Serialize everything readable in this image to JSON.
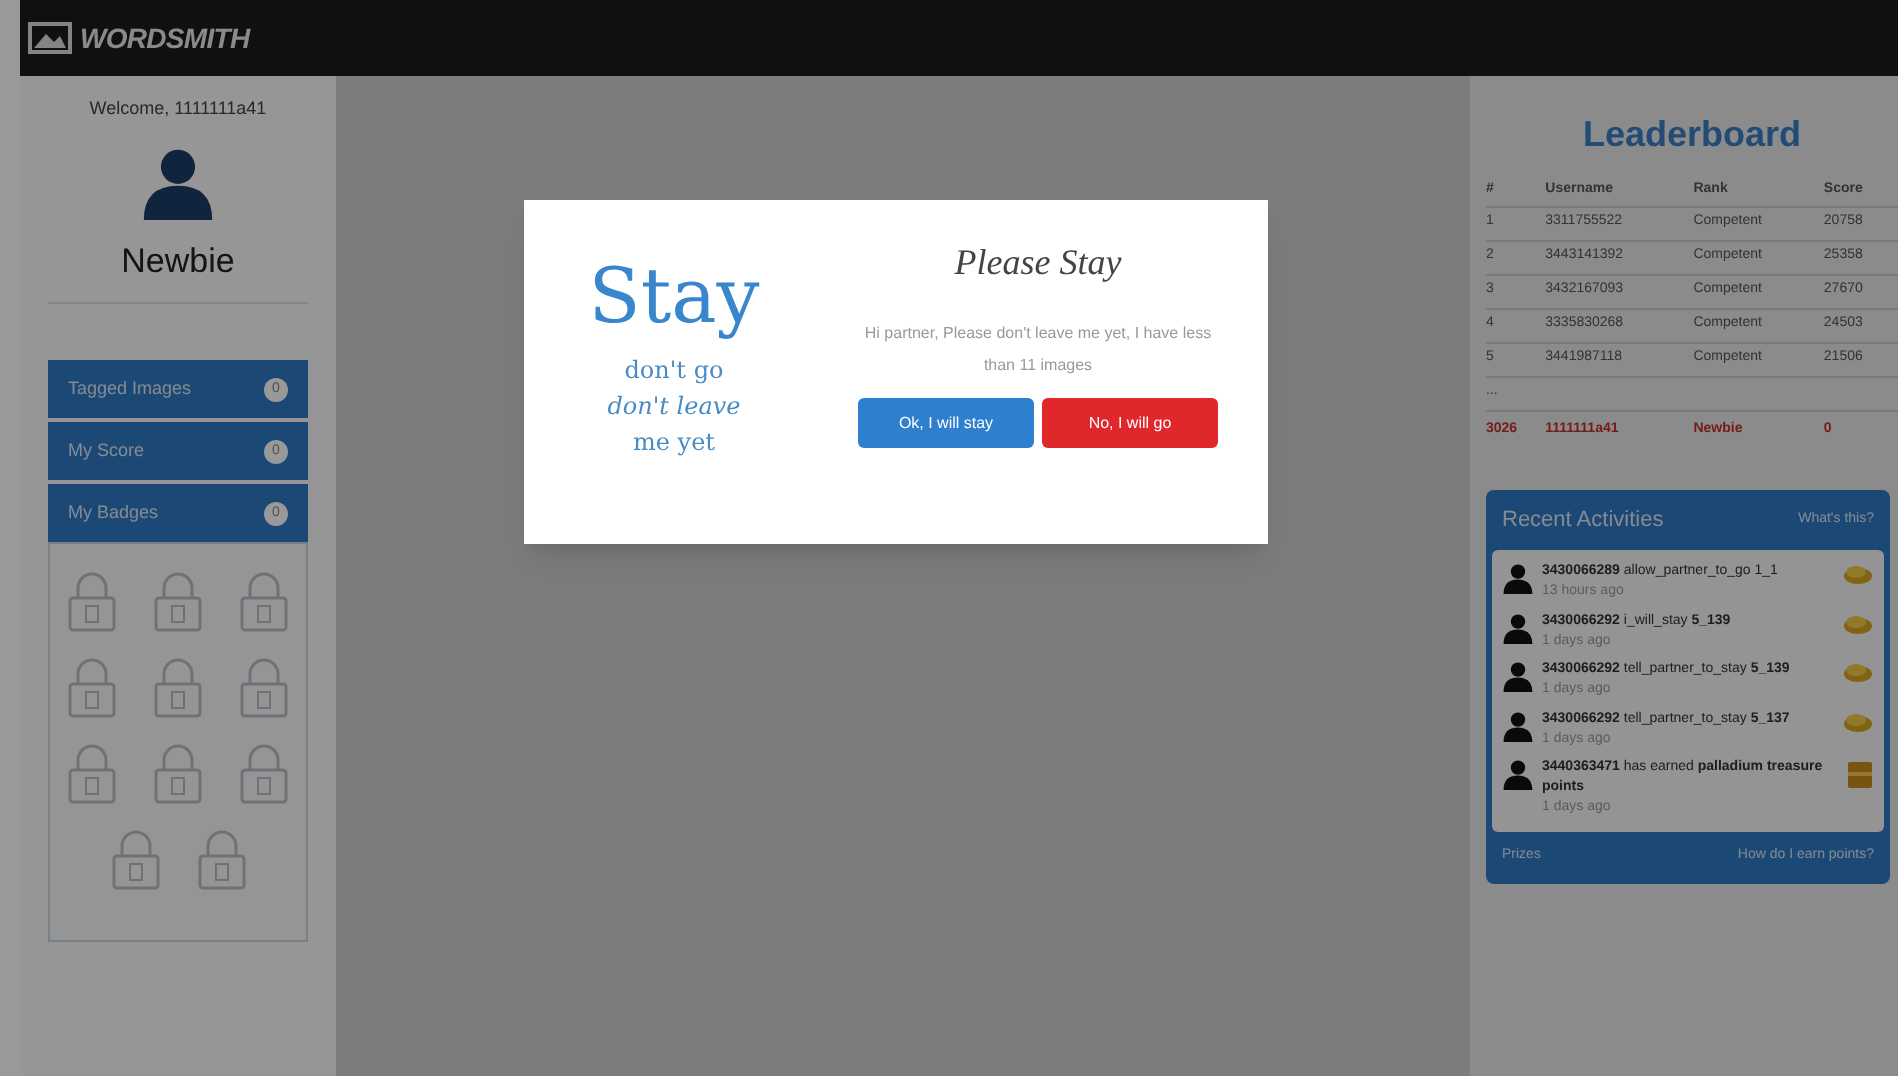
{
  "brand": "WORDSMITH",
  "sidebar": {
    "welcome": "Welcome, 1111111a41",
    "level": "Newbie",
    "items": [
      {
        "label": "Tagged Images",
        "count": "0"
      },
      {
        "label": "My Score",
        "count": "0"
      },
      {
        "label": "My Badges",
        "count": "0"
      }
    ],
    "badges": [
      {
        "locked": true
      },
      {
        "locked": true
      },
      {
        "locked": true
      },
      {
        "locked": true
      },
      {
        "locked": true
      },
      {
        "locked": true
      },
      {
        "locked": true
      },
      {
        "locked": true
      },
      {
        "locked": true
      },
      {
        "locked": true
      },
      {
        "locked": true
      }
    ]
  },
  "modal": {
    "big": "Stay",
    "lines": [
      {
        "text": "don't go",
        "italic": false
      },
      {
        "text": "don't leave",
        "italic": true
      },
      {
        "text": "me yet",
        "italic": false
      }
    ],
    "title": "Please Stay",
    "message": "Hi partner, Please don't leave me yet, I have less than 11 images",
    "buttons": [
      {
        "label": "Ok, I will stay",
        "kind": "primary"
      },
      {
        "label": "No, I will go",
        "kind": "danger"
      }
    ]
  },
  "leaderboard": {
    "title": "Leaderboard",
    "columns": [
      "#",
      "Username",
      "Rank",
      "Score"
    ],
    "rows": [
      [
        "1",
        "3311755522",
        "Competent",
        "20758"
      ],
      [
        "2",
        "3443141392",
        "Competent",
        "25358"
      ],
      [
        "3",
        "3432167093",
        "Competent",
        "27670"
      ],
      [
        "4",
        "3335830268",
        "Competent",
        "24503"
      ],
      [
        "5",
        "3441987118",
        "Competent",
        "21506"
      ]
    ],
    "gap": "...",
    "me": [
      "3026",
      "1111111a41",
      "Newbie",
      "0"
    ]
  },
  "activities": {
    "title": "Recent Activities",
    "help": "What's this?",
    "items": [
      {
        "text": "**3430066289** allow_partner_to_go 1_1",
        "time": "13 hours ago",
        "kind": "coins"
      },
      {
        "text": "**3430066292** i_will_stay **5_139**",
        "time": "1 days ago",
        "kind": "coins"
      },
      {
        "text": "**3430066292** tell_partner_to_stay **5_139**",
        "time": "1 days ago",
        "kind": "coins"
      },
      {
        "text": "**3430066292** tell_partner_to_stay **5_137**",
        "time": "1 days ago",
        "kind": "coins"
      },
      {
        "text": "**3440363471** has earned **palladium treasure points**",
        "time": "1 days ago",
        "kind": "chest"
      }
    ],
    "footer_left": "Prizes",
    "footer_right": "How do I earn points?"
  }
}
